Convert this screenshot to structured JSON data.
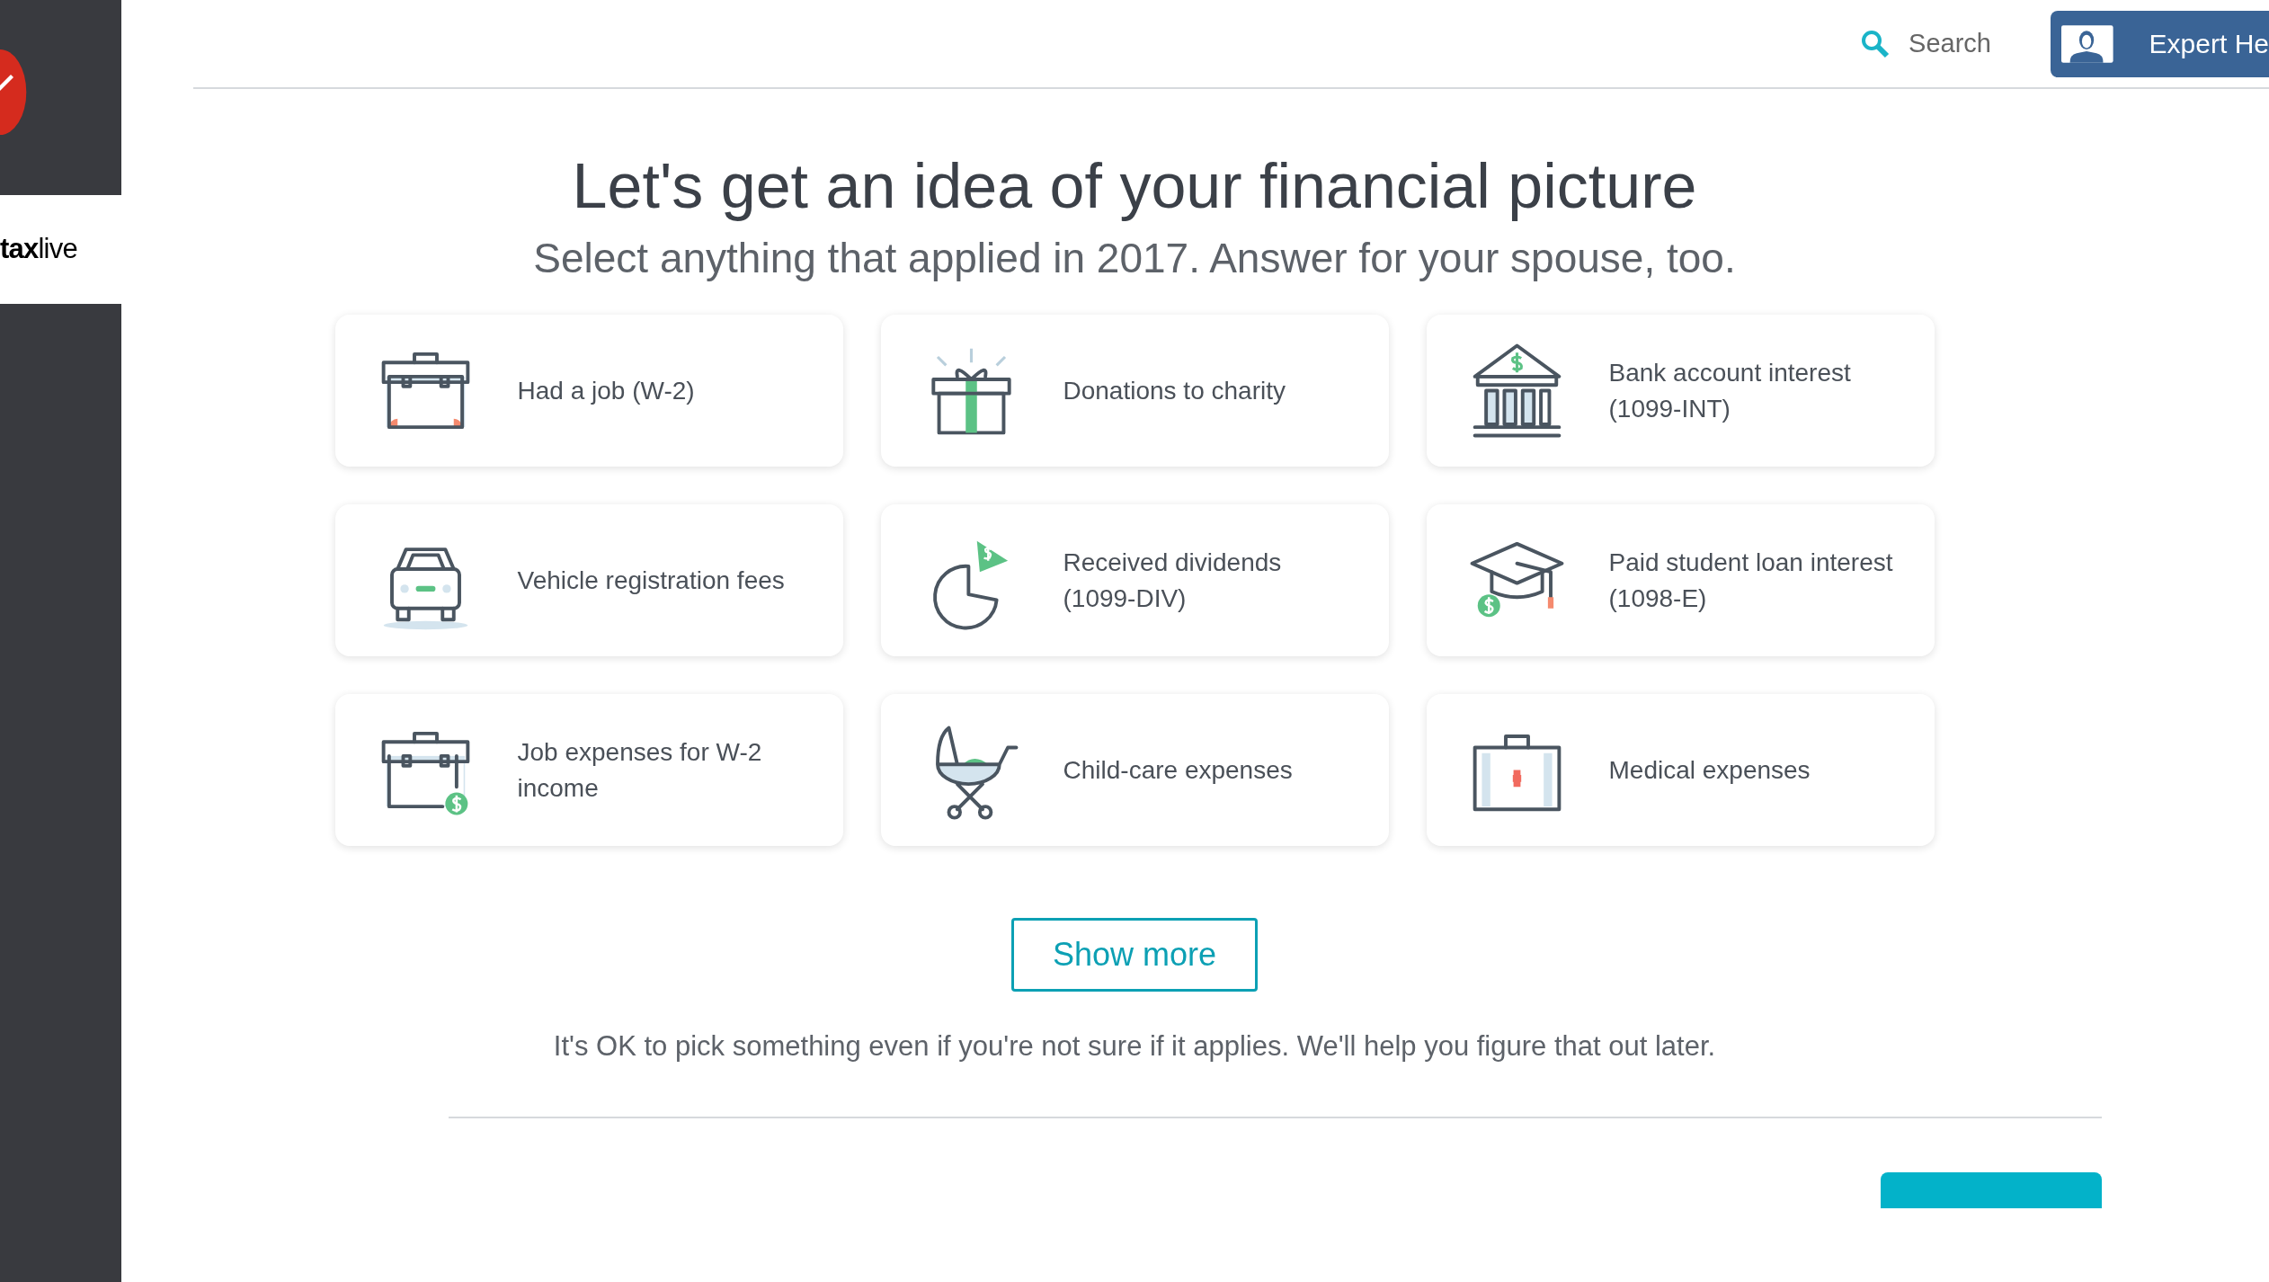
{
  "logo": {
    "bold": "tax",
    "light": "live"
  },
  "header": {
    "search": "Search",
    "expert_button": "Expert He"
  },
  "title": "Let's get an idea of your financial picture",
  "subtitle": "Select anything that applied in 2017. Answer for your spouse, too.",
  "options": [
    {
      "label": "Had a job (W-2)"
    },
    {
      "label": "Donations to charity"
    },
    {
      "label": "Bank account interest (1099-INT)"
    },
    {
      "label": "Vehicle registration fees"
    },
    {
      "label": "Received dividends (1099-DIV)"
    },
    {
      "label": "Paid student loan interest (1098-E)"
    },
    {
      "label": "Job expenses for W-2 income"
    },
    {
      "label": "Child-care expenses"
    },
    {
      "label": "Medical expenses"
    }
  ],
  "show_more": "Show more",
  "note": "It's OK to pick something even if you're not sure if it applies. We'll help you figure that out later."
}
